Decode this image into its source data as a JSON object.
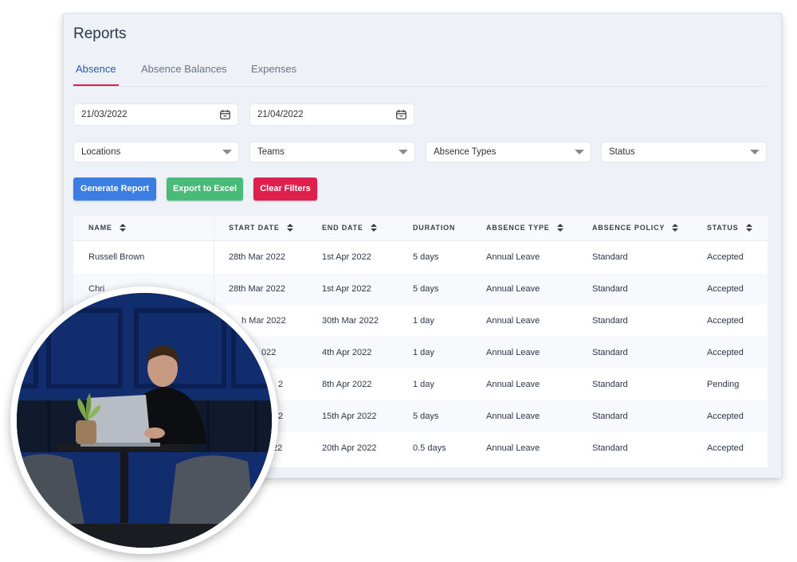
{
  "page": {
    "title": "Reports"
  },
  "tabs": [
    {
      "label": "Absence",
      "active": true
    },
    {
      "label": "Absence Balances",
      "active": false
    },
    {
      "label": "Expenses",
      "active": false
    }
  ],
  "filters": {
    "start_date": "21/03/2022",
    "end_date": "21/04/2022",
    "selects": [
      {
        "label": "Locations"
      },
      {
        "label": "Teams"
      },
      {
        "label": "Absence Types"
      },
      {
        "label": "Status"
      }
    ]
  },
  "buttons": {
    "generate": "Generate Report",
    "export": "Export to Excel",
    "clear": "Clear Filters"
  },
  "table": {
    "columns": [
      "NAME",
      "START DATE",
      "END DATE",
      "DURATION",
      "ABSENCE TYPE",
      "ABSENCE POLICY",
      "STATUS"
    ],
    "rows": [
      {
        "name": "Russell Brown",
        "start": "28th Mar 2022",
        "end": "1st Apr 2022",
        "duration": "5 days",
        "type": "Annual Leave",
        "policy": "Standard",
        "status": "Accepted"
      },
      {
        "name": "Chri",
        "start": "28th Mar 2022",
        "end": "1st Apr 2022",
        "duration": "5 days",
        "type": "Annual Leave",
        "policy": "Standard",
        "status": "Accepted"
      },
      {
        "name": "",
        "start": "h Mar 2022",
        "end": "30th Mar 2022",
        "duration": "1 day",
        "type": "Annual Leave",
        "policy": "Standard",
        "status": "Accepted"
      },
      {
        "name": "",
        "start": "022",
        "end": "4th Apr 2022",
        "duration": "1 day",
        "type": "Annual Leave",
        "policy": "Standard",
        "status": "Accepted"
      },
      {
        "name": "",
        "start": "2",
        "end": "8th Apr 2022",
        "duration": "1 day",
        "type": "Annual Leave",
        "policy": "Standard",
        "status": "Pending"
      },
      {
        "name": "",
        "start": "2",
        "end": "15th Apr 2022",
        "duration": "5 days",
        "type": "Annual Leave",
        "policy": "Standard",
        "status": "Accepted"
      },
      {
        "name": "",
        "start": "22",
        "end": "20th Apr 2022",
        "duration": "0.5 days",
        "type": "Annual Leave",
        "policy": "Standard",
        "status": "Accepted"
      }
    ]
  },
  "colors": {
    "primary_blue": "#3b7de0",
    "success_green": "#48bb78",
    "danger_red": "#e0204c",
    "active_tab": "#2b56b4",
    "tab_underline": "#e11d48"
  },
  "icons": {
    "date": "calendar-icon",
    "select": "chevron-down-icon",
    "sort": "sort-icon"
  }
}
